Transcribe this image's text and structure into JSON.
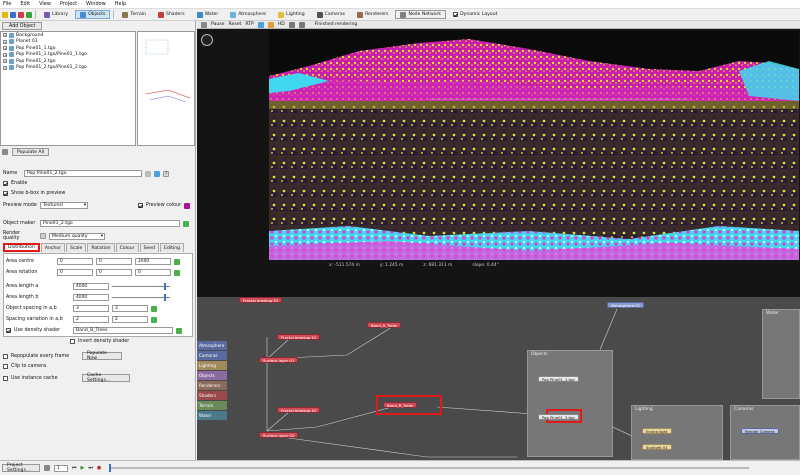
{
  "menu": [
    "File",
    "Edit",
    "View",
    "Project",
    "Window",
    "Help"
  ],
  "toolbar": {
    "tabs": [
      "Library",
      "Objects",
      "Terrain",
      "Shaders",
      "Water",
      "Atmosphere",
      "Lighting",
      "Cameras",
      "Renderers",
      "Node Network"
    ],
    "active_tab": "Objects",
    "dynamic_layout_label": "Dynamic Layout"
  },
  "objects_panel": {
    "add_object_label": "Add Object",
    "tree_items": [
      "Background",
      "Planet 01",
      "Pop Pine01_1.tgo",
      "Pop Pine01_1.tgo/Pine01_1.tgo",
      "Pop Pine01_2.tgo",
      "Pop Pine01_2.tgo/Pine01_2.tgo"
    ],
    "populate_all_label": "Populate All"
  },
  "properties": {
    "name_label": "Name",
    "name_value": "Pop Pine01_2.tgo",
    "enable_label": "Enable",
    "show_bbox_label": "Show b-box in preview",
    "preview_mode_label": "Preview mode",
    "preview_mode_value": "Textured",
    "preview_colour_label": "Preview colour",
    "object_maker_label": "Object maker",
    "object_maker_value": "Pine01_2.tgo",
    "render_quality_label": "Render quality",
    "render_quality_value": "Medium quality",
    "tabs": [
      "Distribution",
      "Anchor",
      "Scale",
      "Rotation",
      "Colour",
      "Seed",
      "Editing"
    ],
    "active_tab": "Distribution",
    "area_centre_label": "Area centre",
    "area_centre_values": [
      "0",
      "0",
      "2000"
    ],
    "area_rotation_label": "Area rotation",
    "area_rotation_values": [
      "0",
      "0",
      "0"
    ],
    "area_length_a_label": "Area length a",
    "area_length_a_value": "4000",
    "area_length_b_label": "Area length b",
    "area_length_b_value": "4000",
    "object_spacing_label": "Object spacing in a,b",
    "object_spacing_values": [
      "3",
      "3"
    ],
    "spacing_variation_label": "Spacing variation in a,b",
    "spacing_variation_values": [
      "2",
      "2"
    ],
    "use_density_shader_label": "Use density shader",
    "density_shader_value": "Band_B_Trees",
    "invert_density_label": "Invert density shader",
    "repopulate_label": "Repopulate every frame",
    "populate_now_label": "Populate Now",
    "clip_camera_label": "Clip to camera",
    "instance_cache_label": "Use instance cache",
    "cache_settings_label": "Cache Settings..."
  },
  "viewport": {
    "buttons": [
      "Pause",
      "Reset",
      "RTP",
      "HD"
    ],
    "status_text": "Finished rendering",
    "coord_x": "x: -511.574 m",
    "coord_y": "y: 1.245 m",
    "coord_z": "z: 681.311 m",
    "slope": "slope: 0.44°"
  },
  "node_network": {
    "categories": [
      {
        "label": "Atmosphere",
        "color": "#5a6aa0"
      },
      {
        "label": "Cameras",
        "color": "#5a6aa0"
      },
      {
        "label": "Lighting",
        "color": "#a08a5a"
      },
      {
        "label": "Objects",
        "color": "#8a6aa0"
      },
      {
        "label": "Renderers",
        "color": "#8a6a5a"
      },
      {
        "label": "Shaders",
        "color": "#9a4a4a"
      },
      {
        "label": "Terrain",
        "color": "#6a8a5a"
      },
      {
        "label": "Water",
        "color": "#4a7a8a"
      }
    ],
    "nodes": {
      "fractal_breakup_01": "Fractal breakup 01",
      "surface_layer_01": "Surface layer 01",
      "fractal_breakup_02": "Fractal breakup 02",
      "surface_layer_02": "Surface layer 02",
      "band_a_trees": "Band_A_Trees",
      "band_b_trees": "Band_B_Trees",
      "pop_pine": "Pop Pine01_1.tgo",
      "pop_pine2": "Pop Pine01_2.tgo",
      "atmosphere_01": "Atmosphere 01",
      "enviro_light": "Enviro light",
      "sunlight": "Sunlight 01",
      "render_camera": "Render Camera"
    },
    "groups": [
      "Objects",
      "Lighting",
      "Cameras",
      "Water"
    ]
  },
  "statusbar": {
    "project_settings_label": "Project Settings...",
    "frame_value": "1"
  }
}
